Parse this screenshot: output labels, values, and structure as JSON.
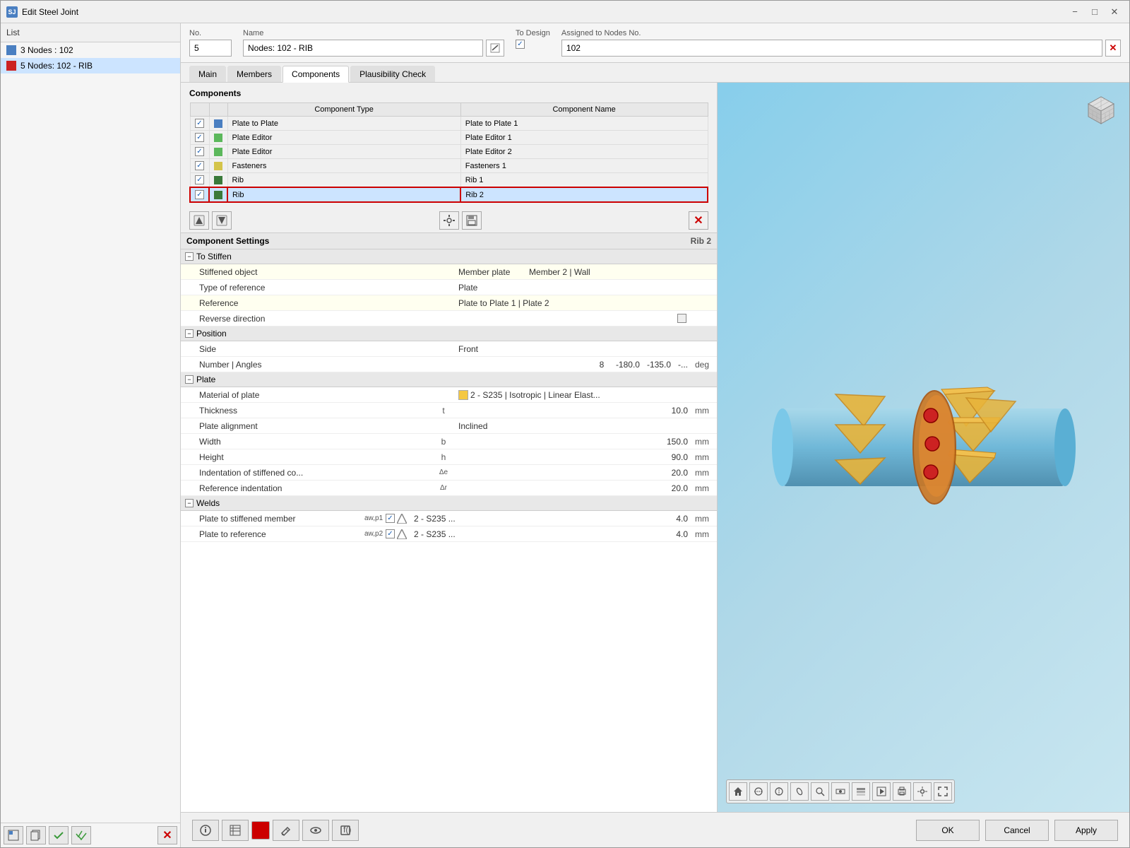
{
  "window": {
    "title": "Edit Steel Joint",
    "icon": "SJ"
  },
  "sidebar": {
    "header": "List",
    "items": [
      {
        "id": "item1",
        "label": "3 Nodes : 102",
        "color": "#4a7fc1",
        "selected": false
      },
      {
        "id": "item2",
        "label": "5 Nodes: 102 - RIB",
        "color": "#cc2222",
        "selected": true
      }
    ],
    "footer_buttons": [
      "copy-icon",
      "paste-icon",
      "check-icon",
      "check2-icon",
      "delete-icon"
    ]
  },
  "form": {
    "no_label": "No.",
    "no_value": "5",
    "name_label": "Name",
    "name_value": "Nodes: 102 - RIB",
    "to_design_label": "To Design",
    "to_design_checked": true,
    "assigned_label": "Assigned to Nodes No.",
    "assigned_value": "102"
  },
  "tabs": [
    {
      "id": "main",
      "label": "Main"
    },
    {
      "id": "members",
      "label": "Members"
    },
    {
      "id": "components",
      "label": "Components",
      "active": true
    },
    {
      "id": "plausibility",
      "label": "Plausibility Check"
    }
  ],
  "components_section": {
    "title": "Components",
    "col_type": "Component Type",
    "col_name": "Component Name",
    "rows": [
      {
        "checked": true,
        "color": "#4a7fc1",
        "type": "Plate to Plate",
        "name": "Plate to Plate 1",
        "selected": false
      },
      {
        "checked": true,
        "color": "#5cb85c",
        "type": "Plate Editor",
        "name": "Plate Editor 1",
        "selected": false
      },
      {
        "checked": true,
        "color": "#5cb85c",
        "type": "Plate Editor",
        "name": "Plate Editor 2",
        "selected": false
      },
      {
        "checked": true,
        "color": "#d4c44a",
        "type": "Fasteners",
        "name": "Fasteners 1",
        "selected": false
      },
      {
        "checked": true,
        "color": "#3a7a3a",
        "type": "Rib",
        "name": "Rib 1",
        "selected": false
      },
      {
        "checked": true,
        "color": "#3a7a3a",
        "type": "Rib",
        "name": "Rib 2",
        "selected": true,
        "red_border": true
      }
    ]
  },
  "comp_toolbar_buttons": [
    {
      "id": "btn-up",
      "icon": "←",
      "title": "Move up"
    },
    {
      "id": "btn-down",
      "icon": "→",
      "title": "Move down"
    },
    {
      "id": "btn-edit",
      "icon": "✎",
      "title": "Edit"
    },
    {
      "id": "btn-save",
      "icon": "💾",
      "title": "Save"
    }
  ],
  "comp_settings": {
    "header": "Component Settings",
    "rib_name": "Rib 2",
    "groups": [
      {
        "id": "to-stiffen",
        "label": "To Stiffen",
        "collapsed": false,
        "rows": [
          {
            "indent": 1,
            "label": "Stiffened object",
            "symbol": "",
            "value": "Member plate",
            "value2": "Member 2 | Wall",
            "unit": "",
            "yellow": true
          },
          {
            "indent": 1,
            "label": "Type of reference",
            "symbol": "",
            "value": "Plate",
            "unit": "",
            "yellow": false
          },
          {
            "indent": 1,
            "label": "Reference",
            "symbol": "",
            "value": "Plate to Plate 1 | Plate  2",
            "unit": "",
            "yellow": true
          },
          {
            "indent": 1,
            "label": "Reverse direction",
            "symbol": "",
            "value": "checkbox",
            "unit": "",
            "yellow": false
          }
        ]
      },
      {
        "id": "position",
        "label": "Position",
        "collapsed": false,
        "rows": [
          {
            "indent": 1,
            "label": "Side",
            "symbol": "",
            "value": "Front",
            "unit": "",
            "yellow": false
          },
          {
            "indent": 1,
            "label": "Number | Angles",
            "symbol": "",
            "value": "8     -180.0  -135.0  -...",
            "unit": "deg",
            "yellow": false
          }
        ]
      },
      {
        "id": "plate",
        "label": "Plate",
        "collapsed": false,
        "rows": [
          {
            "indent": 1,
            "label": "Material of plate",
            "symbol": "",
            "value": "2 - S235 | Isotropic | Linear Elast...",
            "unit": "",
            "yellow": false,
            "has_swatch": true
          },
          {
            "indent": 1,
            "label": "Thickness",
            "symbol": "t",
            "value": "10.0",
            "unit": "mm",
            "yellow": false
          },
          {
            "indent": 1,
            "label": "Plate alignment",
            "symbol": "",
            "value": "Inclined",
            "unit": "",
            "yellow": false
          },
          {
            "indent": 1,
            "label": "Width",
            "symbol": "b",
            "value": "150.0",
            "unit": "mm",
            "yellow": false
          },
          {
            "indent": 1,
            "label": "Height",
            "symbol": "h",
            "value": "90.0",
            "unit": "mm",
            "yellow": false
          },
          {
            "indent": 1,
            "label": "Indentation of stiffened co...",
            "symbol": "Δe",
            "value": "20.0",
            "unit": "mm",
            "yellow": false
          },
          {
            "indent": 1,
            "label": "Reference indentation",
            "symbol": "Δr",
            "value": "20.0",
            "unit": "mm",
            "yellow": false
          }
        ]
      },
      {
        "id": "welds",
        "label": "Welds",
        "collapsed": false,
        "rows": [
          {
            "indent": 1,
            "label": "Plate to stiffened member",
            "symbol": "aw,p1",
            "value": "2 - S235 ...",
            "value_num": "4.0",
            "unit": "mm",
            "yellow": false,
            "has_weld_check": true
          },
          {
            "indent": 1,
            "label": "Plate to reference",
            "symbol": "aw,p2",
            "value": "2 - S235 ...",
            "value_num": "4.0",
            "unit": "mm",
            "yellow": false,
            "has_weld_check": true
          }
        ]
      }
    ]
  },
  "viewport": {
    "toolbar_buttons": [
      "home",
      "rotate-x",
      "rotate-y",
      "rotate-z",
      "zoom",
      "view",
      "layers",
      "render",
      "print",
      "settings",
      "fit"
    ]
  },
  "action_bar": {
    "left_buttons": [
      "info-btn",
      "table-btn",
      "red-btn",
      "edit-btn",
      "eye-btn",
      "calc-btn"
    ],
    "ok_label": "OK",
    "cancel_label": "Cancel",
    "apply_label": "Apply"
  }
}
